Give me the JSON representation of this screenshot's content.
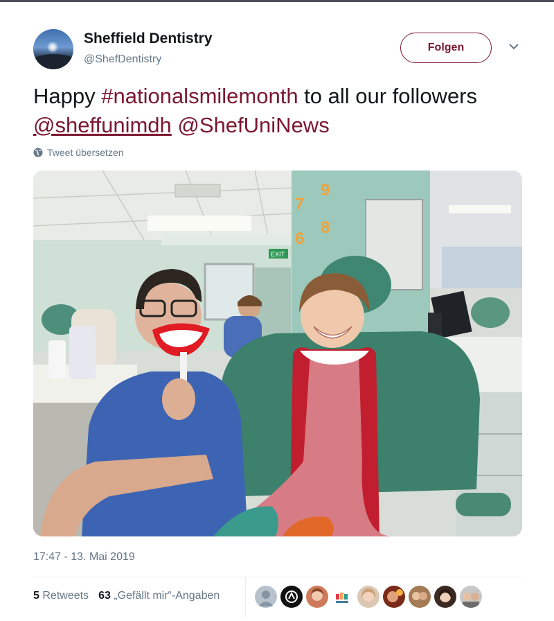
{
  "account": {
    "display_name": "Sheffield Dentistry",
    "handle": "@ShefDentistry"
  },
  "follow_button": {
    "label": "Folgen"
  },
  "tweet": {
    "text_1": "Happy ",
    "hashtag": "#nationalsmilemonth",
    "text_2": " to all our followers ",
    "mention_1": "@sheffunimdh",
    "text_3": " ",
    "mention_2": "@ShefUniNews"
  },
  "translate_label": "Tweet übersetzen",
  "photo": {
    "number_signs": [
      "7",
      "9",
      "6",
      "8"
    ],
    "exit_sign": "EXIT"
  },
  "timestamp": "17:47 - 13. Mai 2019",
  "stats": {
    "retweets_count": "5",
    "retweets_label": "Retweets",
    "likes_count": "63",
    "likes_label": "„Gefällt mir“-Angaben"
  },
  "likers": [
    "avatar-1",
    "avatar-2",
    "avatar-3",
    "avatar-4",
    "avatar-5",
    "avatar-6",
    "avatar-7",
    "avatar-8",
    "avatar-9"
  ],
  "colors": {
    "accent": "#7b1730",
    "muted": "#657786",
    "text": "#14171a"
  }
}
